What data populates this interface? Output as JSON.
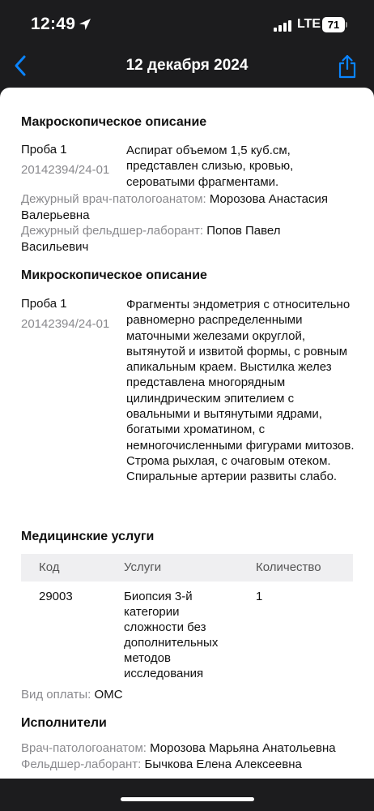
{
  "status_bar": {
    "time": "12:49",
    "network": "LTE",
    "battery": "71"
  },
  "nav": {
    "title": "12 декабря 2024"
  },
  "macro": {
    "title": "Макроскопическое описание",
    "sample_label": "Проба 1",
    "sample_id": "20142394/24-01",
    "description": "Аспират объемом 1,5 куб.см, представлен слизью, кровью, сероватыми фрагментами.",
    "doctor_label": "Дежурный врач-патологоанатом:",
    "doctor_name": "Морозова Анастасия Валерьевна",
    "assistant_label": "Дежурный фельдшер-лаборант:",
    "assistant_name": "Попов Павел Васильевич"
  },
  "micro": {
    "title": "Микроскопическое описание",
    "sample_label": "Проба 1",
    "sample_id": "20142394/24-01",
    "description": "Фрагменты эндометрия с относительно равномерно распределенными маточными железами округлой, вытянутой и извитой формы, с ровным апикальным краем. Выстилка желез представлена многорядным цилиндрическим эпителием с овальными и вытянутыми ядрами, богатыми хроматином, с немногочисленными фигурами митозов. Строма рыхлая, с очаговым отеком. Спиральные артерии развиты слабо."
  },
  "services": {
    "title": "Медицинские услуги",
    "columns": [
      "Код",
      "Услуги",
      "Количество"
    ],
    "rows": [
      {
        "code": "29003",
        "service": "Биопсия 3-й категории сложности без дополнительных методов исследования",
        "quantity": "1"
      }
    ],
    "payment_label": "Вид оплаты:",
    "payment_value": "ОМС"
  },
  "performers": {
    "title": "Исполнители",
    "doctor_label": "Врач-патологоанатом:",
    "doctor_name": "Морозова Марьяна Анатольевна",
    "assistant_label": "Фельдшер-лаборант:",
    "assistant_name": "Бычкова Елена Алексеевна"
  },
  "colors": {
    "accent": "#0a84ff",
    "background": "#1c1c1e",
    "card": "#ffffff",
    "secondary_text": "#8a8a8e"
  }
}
